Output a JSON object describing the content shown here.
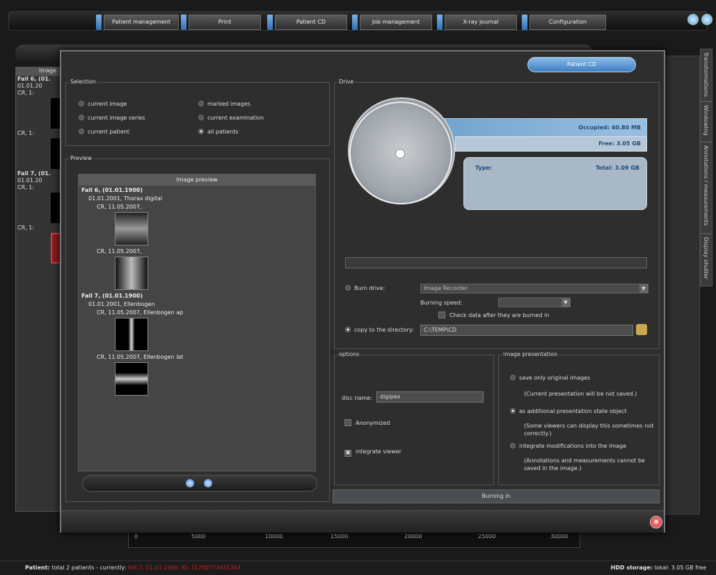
{
  "menu": {
    "tabs": [
      "Patient management",
      "Print",
      "Patient CD",
      "Job management",
      "X-ray journal",
      "Configuration"
    ]
  },
  "side_tabs": [
    "Transformations",
    "Windowing",
    "Annotations / measurements",
    "Display shutter"
  ],
  "left_tree": {
    "header": "Image",
    "rows": [
      "Fall 6, (01.",
      "01.01.20",
      "CR, 1:",
      "CR, 1:",
      "Fall 7, (01.",
      "01.01.20",
      "CR, 1:",
      "CR, 1:"
    ]
  },
  "ruler": [
    "0",
    "5000",
    "10000",
    "15000",
    "20000",
    "25000",
    "30000"
  ],
  "status": {
    "patient_label": "Patient:",
    "patient_text": "total 2 patients - currently:",
    "patient_current": "Fall 7, 01.01.1900, ID: 11780773431343",
    "hdd_label": "HDD storage:",
    "hdd_text": "lokal: 3.05 GB free"
  },
  "dialog": {
    "title": "Patient CD",
    "selection": {
      "title": "Selection",
      "options": [
        "current image",
        "marked images",
        "current image series",
        "current examination",
        "current patient",
        "all patients"
      ],
      "selected": "all patients"
    },
    "preview": {
      "title": "Preview",
      "header": "Image preview",
      "tree": [
        "Fall 6, (01.01.1900)",
        "01.01.2001, Thorax digital",
        "CR, 11.05.2007,",
        "CR, 11.05.2007,",
        "Fall 7, (01.01.1900)",
        "01.01.2001, Ellenbogen",
        "CR, 11.05.2007, Ellenbogen ap",
        "CR, 11.05.2007, Ellenbogen lat"
      ]
    },
    "drive": {
      "title": "Drive",
      "occupied": "Occupied: 40.80 MB",
      "free": "Free: 3.05 GB",
      "type_label": "Type:",
      "total": "Total: 3.09 GB",
      "burn_label": "Burn drive:",
      "burn_device": "Image Recorder",
      "speed_label": "Burning speed:",
      "check_label": "Check data after they are burned in",
      "copy_label": "copy to the directory:",
      "copy_path": "C:\\TEMP\\CD"
    },
    "options": {
      "title": "options",
      "disc_label": "disc name:",
      "disc_value": "digipax",
      "anonymized": "Anonymized",
      "integrate_viewer": "integrate viewer"
    },
    "presentation": {
      "title": "image presentation",
      "opt1": "save only original images",
      "note1": "(Current presentation will be not saved.)",
      "opt2": "as additional presentation state object",
      "note2": "(Some viewers can display this sometimes not correctly.)",
      "opt3": "integrate modifications into the image",
      "note3": "(Annotations and measurements cannot be saved in the image.)"
    },
    "burn_button": "Burning in"
  }
}
